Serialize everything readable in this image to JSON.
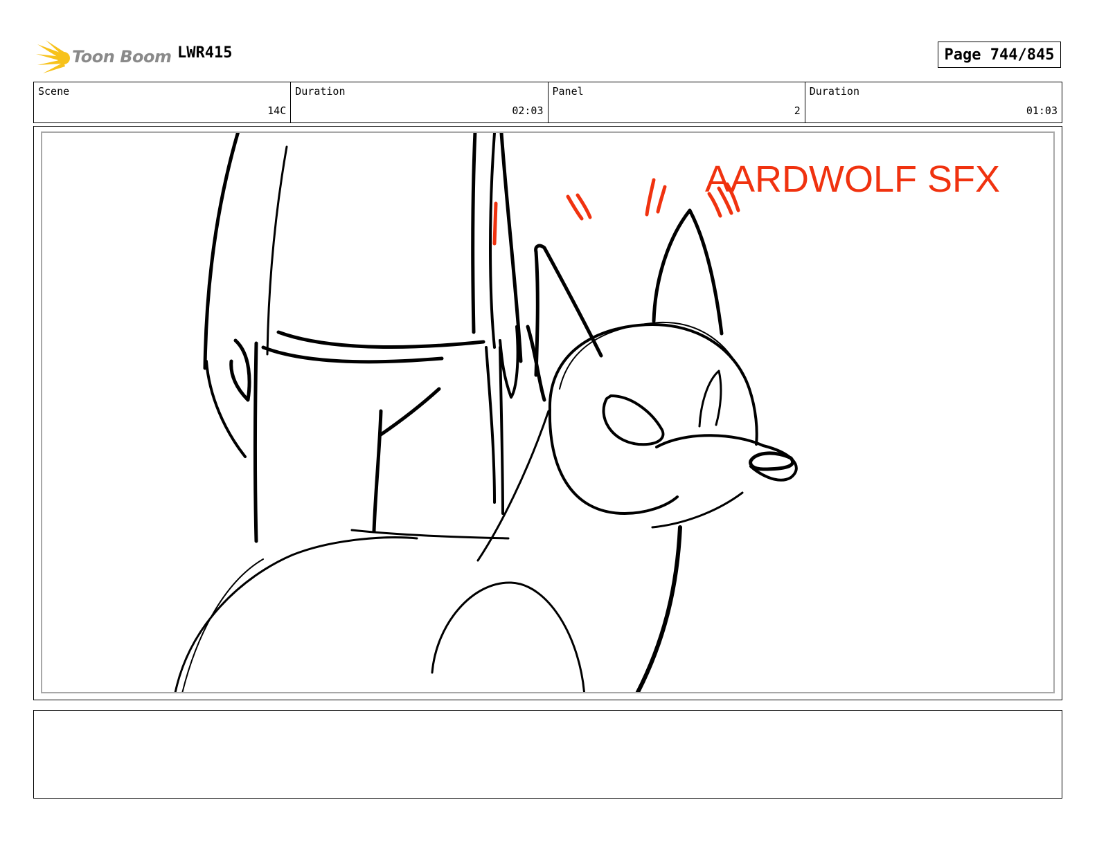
{
  "header": {
    "logo_text": "Toon Boom",
    "project_code": "LWR415",
    "page_label": "Page 744/845"
  },
  "info": {
    "scene_label": "Scene",
    "scene_value": "14C",
    "scene_duration_label": "Duration",
    "scene_duration_value": "02:03",
    "panel_label": "Panel",
    "panel_value": "2",
    "panel_duration_label": "Duration",
    "panel_duration_value": "01:03"
  },
  "panel": {
    "sfx_text": "AARDWOLF SFX"
  },
  "notes": {
    "text": ""
  },
  "colors": {
    "sfx_red": "#f0320f",
    "logo_yellow": "#f7c21b",
    "logo_gray": "#8a8a8a"
  }
}
